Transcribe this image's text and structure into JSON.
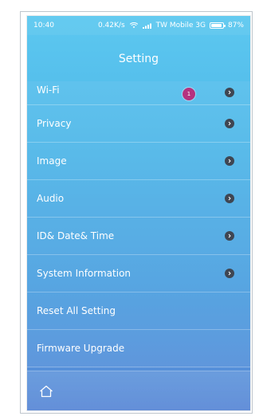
{
  "status_bar": {
    "time": "10:40",
    "speed": "0.42K/s",
    "carrier": "TW Mobile 3G",
    "battery": "87%"
  },
  "header": {
    "title": "Setting"
  },
  "menu": {
    "items": [
      {
        "label": "Wi-Fi",
        "badge": "1",
        "has_chevron": true
      },
      {
        "label": "Privacy",
        "has_chevron": true
      },
      {
        "label": "Image",
        "has_chevron": true
      },
      {
        "label": "Audio",
        "has_chevron": true
      },
      {
        "label": "ID& Date& Time",
        "has_chevron": true
      },
      {
        "label": "System Information",
        "has_chevron": true
      },
      {
        "label": "Reset All Setting",
        "has_chevron": false
      },
      {
        "label": "Firmware Upgrade",
        "has_chevron": false
      }
    ]
  },
  "icons": {
    "home": "home-icon",
    "chevron": "chevron-right-icon",
    "wifi": "wifi-icon",
    "signal": "signal-icon",
    "battery": "battery-icon"
  },
  "colors": {
    "badge": "#b5327f",
    "chevron_bg": "#3f4652"
  }
}
